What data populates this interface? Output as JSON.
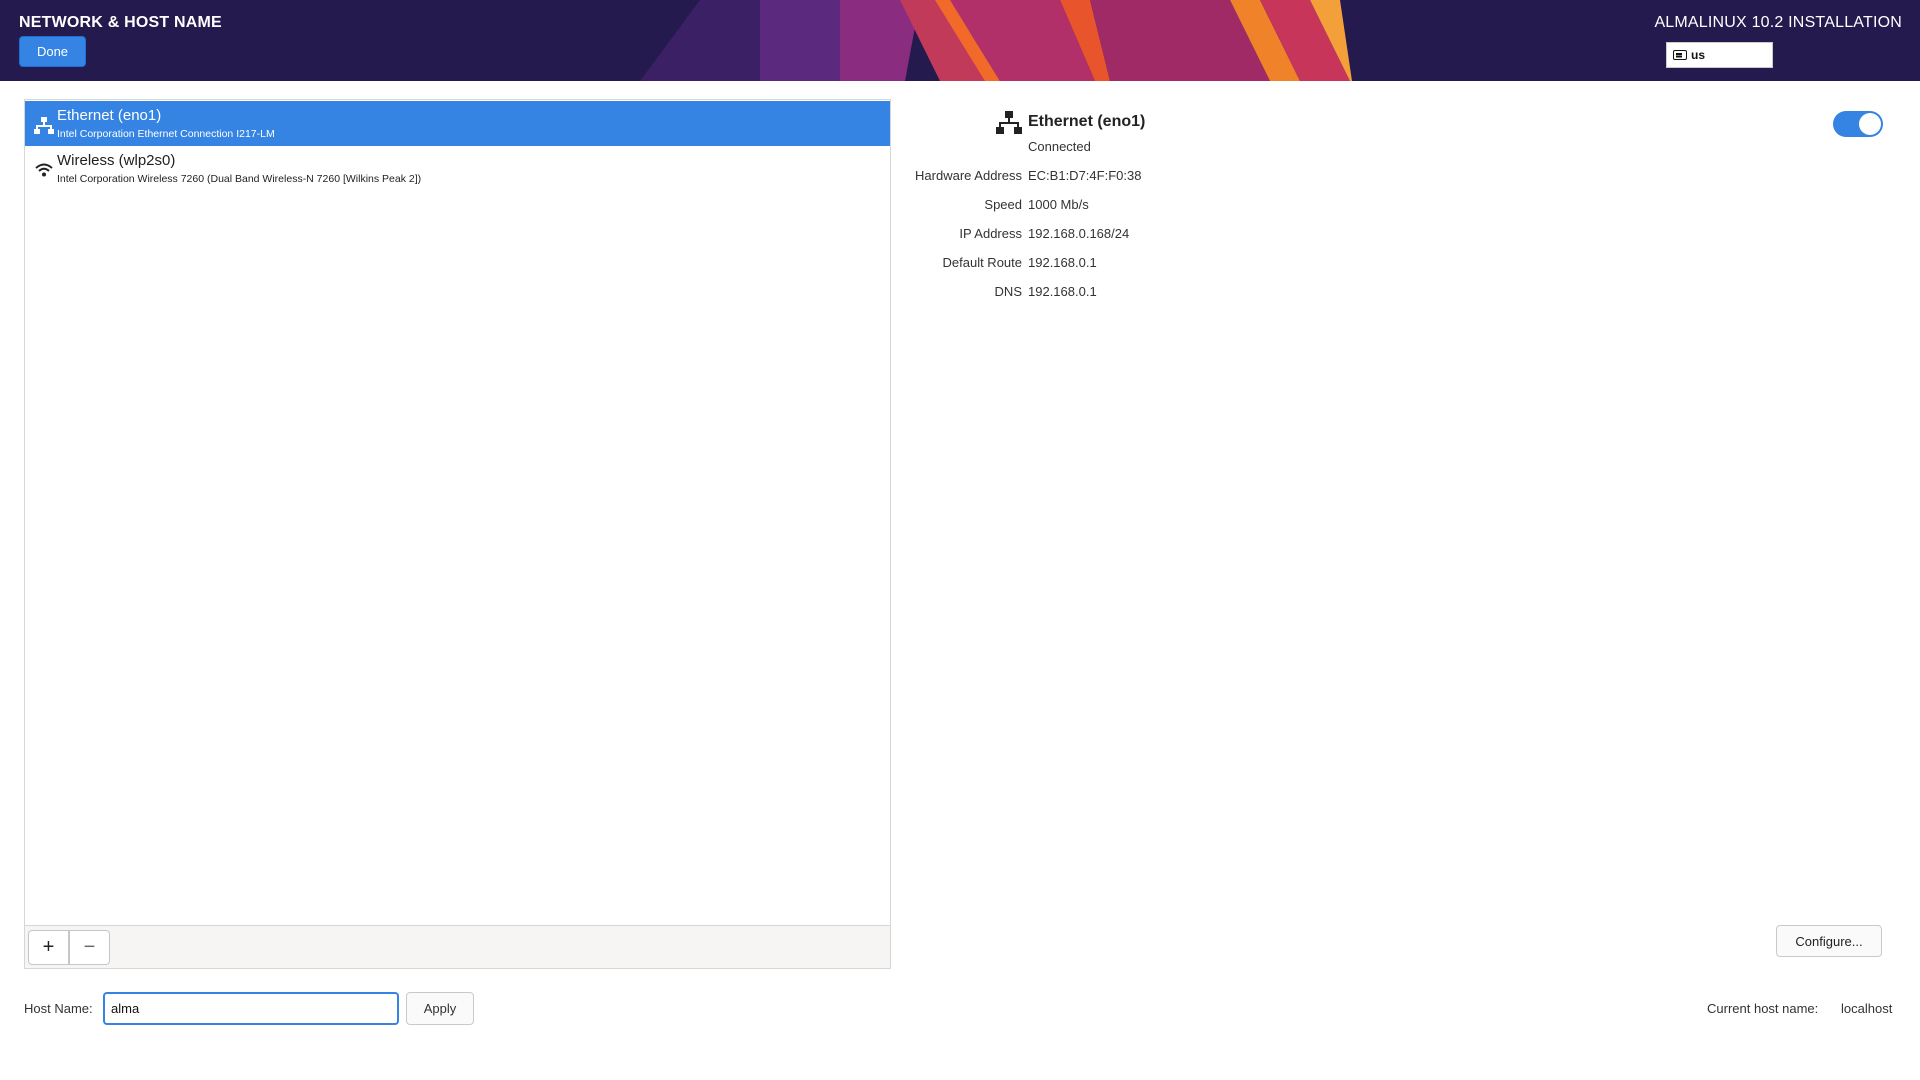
{
  "header": {
    "spoke_title": "NETWORK & HOST NAME",
    "done_label": "Done",
    "product_title": "ALMALINUX 10.2 INSTALLATION",
    "keyboard_layout": "us",
    "keyboard_icon": "keyboard-icon"
  },
  "devices": [
    {
      "name": "Ethernet (eno1)",
      "description": "Intel Corporation Ethernet Connection I217-LM",
      "icon": "ethernet-icon",
      "selected": true
    },
    {
      "name": "Wireless (wlp2s0)",
      "description": "Intel Corporation Wireless 7260 (Dual Band Wireless-N 7260 [Wilkins Peak 2])",
      "icon": "wifi-icon",
      "selected": false
    }
  ],
  "list_toolbar": {
    "add_label": "+",
    "remove_label": "−"
  },
  "details": {
    "name": "Ethernet (eno1)",
    "status": "Connected",
    "enabled": true,
    "properties": [
      {
        "label": "Hardware Address",
        "value": "EC:B1:D7:4F:F0:38"
      },
      {
        "label": "Speed",
        "value": "1000 Mb/s"
      },
      {
        "label": "IP Address",
        "value": "192.168.0.168/24"
      },
      {
        "label": "Default Route",
        "value": "192.168.0.1"
      },
      {
        "label": "DNS",
        "value": "192.168.0.1"
      }
    ],
    "configure_label": "Configure..."
  },
  "hostname": {
    "label": "Host Name:",
    "value": "alma",
    "apply_label": "Apply",
    "current_label": "Current host name:",
    "current_value": "localhost"
  },
  "colors": {
    "accent": "#3584e4",
    "header_bg": "#241a4e"
  }
}
